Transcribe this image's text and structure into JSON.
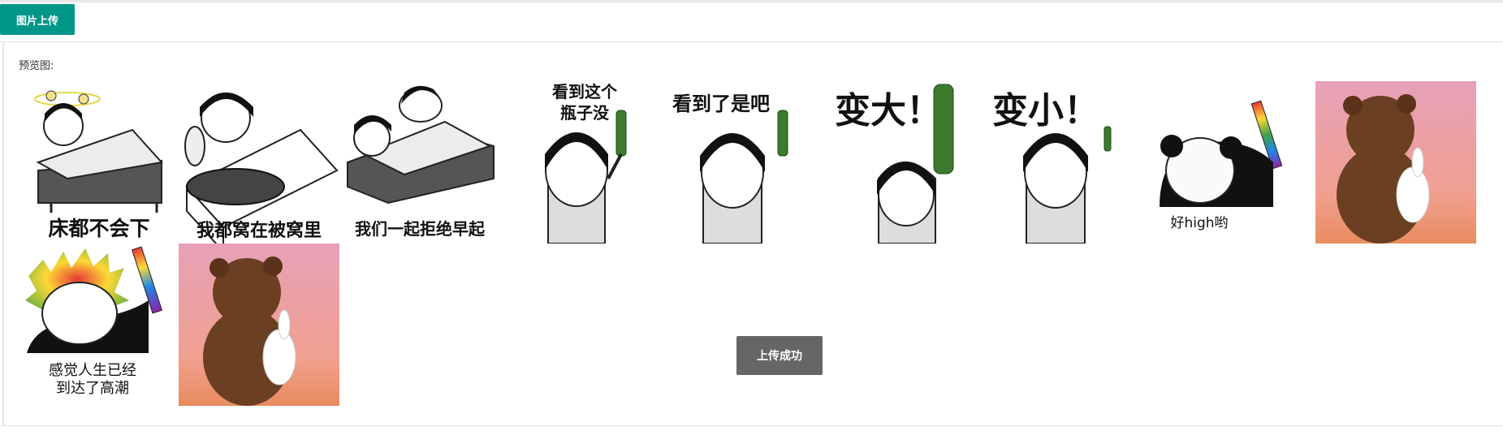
{
  "toolbar": {
    "upload_button_label": "图片上传"
  },
  "preview": {
    "label": "预览图:"
  },
  "images": [
    {
      "caption": "床都不会下",
      "icon": "sleepy-bed-meme"
    },
    {
      "caption": "我都窝在被窝里",
      "icon": "blanket-bed-meme"
    },
    {
      "caption": "我们一起拒绝早起",
      "icon": "two-in-bed-meme"
    },
    {
      "caption": "看到这个\n瓶子没",
      "icon": "bottle-meme"
    },
    {
      "caption": "看到了是吧",
      "icon": "bottle-meme"
    },
    {
      "caption": "变大！",
      "icon": "big-bottle-meme"
    },
    {
      "caption": "变小！",
      "icon": "small-bottle-meme"
    },
    {
      "caption": "好high哟",
      "icon": "panda-glowstick-meme"
    },
    {
      "caption": "",
      "icon": "bear-rabbit-meme"
    },
    {
      "caption": "感觉人生已经\n到达了高潮",
      "icon": "rainbow-hair-meme"
    },
    {
      "caption": "",
      "icon": "bear-rabbit-meme"
    }
  ],
  "status": {
    "success_button_label": "上传成功"
  },
  "colors": {
    "accent": "#009688",
    "success_button": "#666666"
  }
}
